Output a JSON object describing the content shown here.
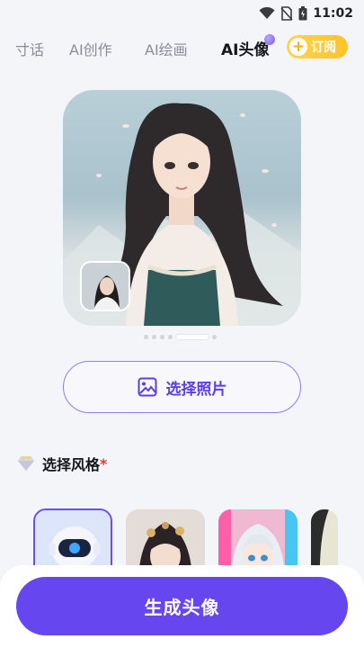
{
  "status_bar": {
    "time": "11:02"
  },
  "tabs": [
    {
      "label": "寸话"
    },
    {
      "label": "AI创作"
    },
    {
      "label": "AI绘画"
    },
    {
      "label": "AI头像",
      "active": true
    }
  ],
  "subscribe": {
    "label": "订阅"
  },
  "hero": {
    "page_count": 5,
    "current_page": 5
  },
  "select_photo": {
    "label": "选择照片",
    "icon": "image-icon"
  },
  "style_section": {
    "title": "选择风格",
    "required_mark": "*",
    "styles": [
      {
        "name": "robot",
        "selected": true
      },
      {
        "name": "ancient-girl",
        "selected": false
      },
      {
        "name": "anime-girl",
        "selected": false
      },
      {
        "name": "partial",
        "selected": false
      }
    ]
  },
  "generate_button": {
    "label": "生成头像"
  },
  "colors": {
    "accent": "#6646ee",
    "subscribe": "#ffc22a",
    "required": "#e53935",
    "background": "#f4f5f9"
  }
}
